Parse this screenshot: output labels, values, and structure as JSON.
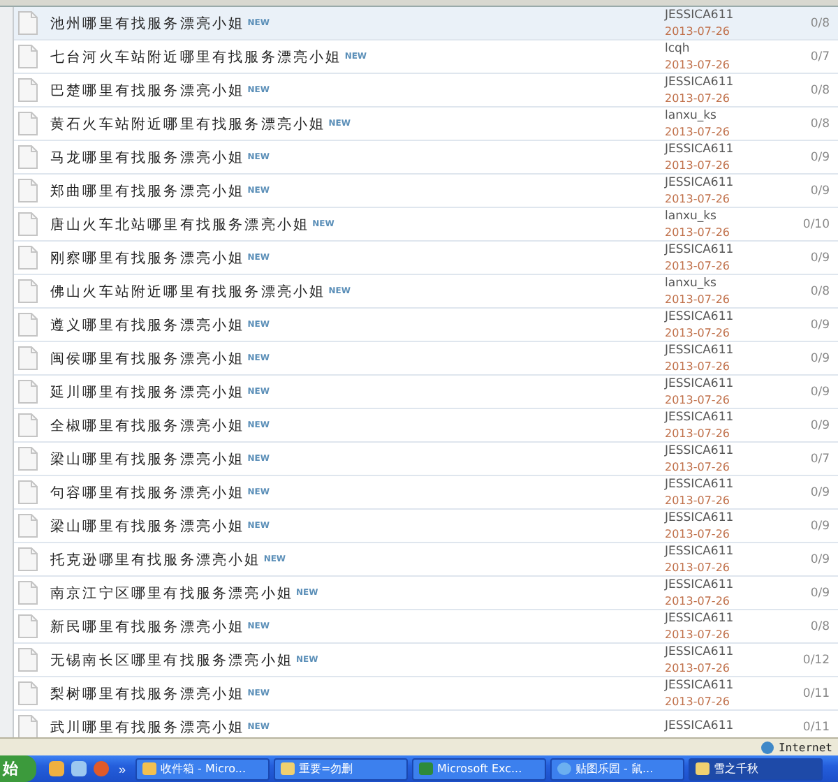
{
  "threads": [
    {
      "title": "池州哪里有找服务漂亮小姐",
      "badge": "NEW",
      "author": "JESSICA611",
      "date": "2013-07-26",
      "replies": "0/8",
      "highlighted": true
    },
    {
      "title": "七台河火车站附近哪里有找服务漂亮小姐",
      "badge": "NEW",
      "author": "lcqh",
      "date": "2013-07-26",
      "replies": "0/7",
      "highlighted": false
    },
    {
      "title": "巴楚哪里有找服务漂亮小姐",
      "badge": "NEW",
      "author": "JESSICA611",
      "date": "2013-07-26",
      "replies": "0/8",
      "highlighted": false
    },
    {
      "title": "黄石火车站附近哪里有找服务漂亮小姐",
      "badge": "NEW",
      "author": "lanxu_ks",
      "date": "2013-07-26",
      "replies": "0/8",
      "highlighted": false
    },
    {
      "title": "马龙哪里有找服务漂亮小姐",
      "badge": "NEW",
      "author": "JESSICA611",
      "date": "2013-07-26",
      "replies": "0/9",
      "highlighted": false
    },
    {
      "title": "郑曲哪里有找服务漂亮小姐",
      "badge": "NEW",
      "author": "JESSICA611",
      "date": "2013-07-26",
      "replies": "0/9",
      "highlighted": false
    },
    {
      "title": "唐山火车北站哪里有找服务漂亮小姐",
      "badge": "NEW",
      "author": "lanxu_ks",
      "date": "2013-07-26",
      "replies": "0/10",
      "highlighted": false
    },
    {
      "title": "刚察哪里有找服务漂亮小姐",
      "badge": "NEW",
      "author": "JESSICA611",
      "date": "2013-07-26",
      "replies": "0/9",
      "highlighted": false
    },
    {
      "title": "佛山火车站附近哪里有找服务漂亮小姐",
      "badge": "NEW",
      "author": "lanxu_ks",
      "date": "2013-07-26",
      "replies": "0/8",
      "highlighted": false
    },
    {
      "title": "遵义哪里有找服务漂亮小姐",
      "badge": "NEW",
      "author": "JESSICA611",
      "date": "2013-07-26",
      "replies": "0/9",
      "highlighted": false
    },
    {
      "title": "闽侯哪里有找服务漂亮小姐",
      "badge": "NEW",
      "author": "JESSICA611",
      "date": "2013-07-26",
      "replies": "0/9",
      "highlighted": false
    },
    {
      "title": "延川哪里有找服务漂亮小姐",
      "badge": "NEW",
      "author": "JESSICA611",
      "date": "2013-07-26",
      "replies": "0/9",
      "highlighted": false
    },
    {
      "title": "全椒哪里有找服务漂亮小姐",
      "badge": "NEW",
      "author": "JESSICA611",
      "date": "2013-07-26",
      "replies": "0/9",
      "highlighted": false
    },
    {
      "title": "梁山哪里有找服务漂亮小姐",
      "badge": "NEW",
      "author": "JESSICA611",
      "date": "2013-07-26",
      "replies": "0/7",
      "highlighted": false
    },
    {
      "title": "句容哪里有找服务漂亮小姐",
      "badge": "NEW",
      "author": "JESSICA611",
      "date": "2013-07-26",
      "replies": "0/9",
      "highlighted": false
    },
    {
      "title": "梁山哪里有找服务漂亮小姐",
      "badge": "NEW",
      "author": "JESSICA611",
      "date": "2013-07-26",
      "replies": "0/9",
      "highlighted": false
    },
    {
      "title": "托克逊哪里有找服务漂亮小姐",
      "badge": "NEW",
      "author": "JESSICA611",
      "date": "2013-07-26",
      "replies": "0/9",
      "highlighted": false
    },
    {
      "title": "南京江宁区哪里有找服务漂亮小姐",
      "badge": "NEW",
      "author": "JESSICA611",
      "date": "2013-07-26",
      "replies": "0/9",
      "highlighted": false
    },
    {
      "title": "新民哪里有找服务漂亮小姐",
      "badge": "NEW",
      "author": "JESSICA611",
      "date": "2013-07-26",
      "replies": "0/8",
      "highlighted": false
    },
    {
      "title": "无锡南长区哪里有找服务漂亮小姐",
      "badge": "NEW",
      "author": "JESSICA611",
      "date": "2013-07-26",
      "replies": "0/12",
      "highlighted": false
    },
    {
      "title": "梨树哪里有找服务漂亮小姐",
      "badge": "NEW",
      "author": "JESSICA611",
      "date": "2013-07-26",
      "replies": "0/11",
      "highlighted": false
    },
    {
      "title": "武川哪里有找服务漂亮小姐",
      "badge": "NEW",
      "author": "JESSICA611",
      "replies": "0/11",
      "highlighted": false
    }
  ],
  "status_bar": {
    "zone": "Internet"
  },
  "taskbar": {
    "start": "始",
    "more": "»",
    "tasks": [
      {
        "label": "收件箱 - Micro...",
        "kind": "mail",
        "active": false
      },
      {
        "label": "重要=勿删",
        "kind": "folder",
        "active": false
      },
      {
        "label": "Microsoft Exc...",
        "kind": "excel",
        "active": false
      },
      {
        "label": "贴图乐园 - 鼠...",
        "kind": "browser",
        "active": false
      },
      {
        "label": "雪之千秋",
        "kind": "folder",
        "active": true
      }
    ]
  }
}
